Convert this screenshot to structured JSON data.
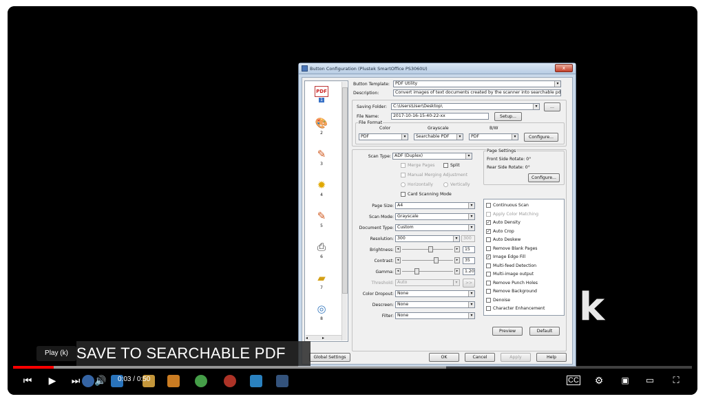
{
  "player": {
    "caption": "SAVE TO SEARCHABLE PDF",
    "watermark_letter": "k",
    "tooltip": "Play (k)",
    "time_current": "0:03",
    "time_separator": "/",
    "time_total": "0:50",
    "progress_played_fraction": 0.06,
    "icons": {
      "previous": "skip-previous-icon",
      "play": "play-icon",
      "next": "skip-next-icon",
      "volume": "volume-icon",
      "captions": "subtitles-icon",
      "settings": "gear-icon",
      "miniplayer": "miniplayer-icon",
      "theater": "theater-mode-icon",
      "fullscreen": "fullscreen-icon"
    }
  },
  "dialog": {
    "title": "Button Configuration (Plustek SmartOffice PS3060U)",
    "close_label": "x",
    "button_list": [
      {
        "num": "1",
        "icon": "pdf-icon"
      },
      {
        "num": "2",
        "icon": "palette-icon"
      },
      {
        "num": "3",
        "icon": "scan-to-app-icon"
      },
      {
        "num": "4",
        "icon": "ocr-icon"
      },
      {
        "num": "5",
        "icon": "scan-to-app-icon"
      },
      {
        "num": "6",
        "icon": "printer-icon"
      },
      {
        "num": "7",
        "icon": "folder-icon"
      },
      {
        "num": "8",
        "icon": "cd-icon"
      }
    ],
    "button_template_label": "Button Template:",
    "button_template_value": "PDF Utility",
    "description_label": "Description:",
    "description_value": "Convert images of text documents created by the scanner into searchable pdf or p",
    "saving_folder_label": "Saving Folder:",
    "saving_folder_value": "C:\\Users\\User\\Desktop\\",
    "browse_label": "...",
    "file_name_label": "File Name:",
    "file_name_value": "2017-10-16-15-40-22-xx",
    "setup_label": "Setup...",
    "file_format_label": "File Format",
    "color_label": "Color",
    "grayscale_label": "Grayscale",
    "bw_label": "B/W",
    "color_value": "PDF",
    "grayscale_value": "Searchable PDF",
    "bw_value": "PDF",
    "configure_label": "Configure...",
    "scan_type_label": "Scan Type:",
    "scan_type_value": "ADF (Duplex)",
    "merge_pages_label": "Merge Pages",
    "split_label": "Split",
    "manual_merging_label": "Manual Merging Adjustment",
    "horizontally_label": "Horizontally",
    "vertically_label": "Vertically",
    "card_scanning_label": "Card Scanning Mode",
    "page_settings_label": "Page Settings",
    "front_rotate_label": "Front Side Rotate: 0°",
    "rear_rotate_label": "Rear Side Rotate: 0°",
    "page_configure_label": "Configure...",
    "page_size_label": "Page Size:",
    "page_size_value": "A4",
    "scan_mode_label": "Scan Mode:",
    "scan_mode_value": "Grayscale",
    "document_type_label": "Document Type:",
    "document_type_value": "Custom",
    "resolution_label": "Resolution:",
    "resolution_value": "300",
    "resolution_extra": "300",
    "brightness_label": "Brightness:",
    "brightness_value": "15",
    "contrast_label": "Contrast:",
    "contrast_value": "35",
    "gamma_label": "Gamma:",
    "gamma_value": "1.20",
    "threshold_label": "Threshold:",
    "threshold_value": "Auto",
    "threshold_btn": ">>",
    "color_dropout_label": "Color Dropout:",
    "color_dropout_value": "None",
    "descreen_label": "Descreen:",
    "descreen_value": "None",
    "filter_label": "Filter:",
    "filter_value": "None",
    "options": [
      {
        "label": "Continuous Scan",
        "checked": false,
        "disabled": false
      },
      {
        "label": "Apply Color Matching",
        "checked": false,
        "disabled": true
      },
      {
        "label": "Auto Density",
        "checked": true,
        "disabled": false
      },
      {
        "label": "Auto Crop",
        "checked": true,
        "disabled": false
      },
      {
        "label": "Auto Deskew",
        "checked": false,
        "disabled": false
      },
      {
        "label": "Remove Blank Pages",
        "checked": false,
        "disabled": false
      },
      {
        "label": "Image Edge Fill",
        "checked": true,
        "disabled": false
      },
      {
        "label": "Multi-feed Detection",
        "checked": false,
        "disabled": false
      },
      {
        "label": "Multi-image output",
        "checked": false,
        "disabled": false
      },
      {
        "label": "Remove Punch Holes",
        "checked": false,
        "disabled": false
      },
      {
        "label": "Remove Background",
        "checked": false,
        "disabled": false
      },
      {
        "label": "Denoise",
        "checked": false,
        "disabled": false
      },
      {
        "label": "Character Enhancement",
        "checked": false,
        "disabled": false
      }
    ],
    "preview_label": "Preview",
    "default_label": "Default",
    "global_settings_label": "Global Settings",
    "ok_label": "OK",
    "cancel_label": "Cancel",
    "apply_label": "Apply",
    "help_label": "Help"
  }
}
